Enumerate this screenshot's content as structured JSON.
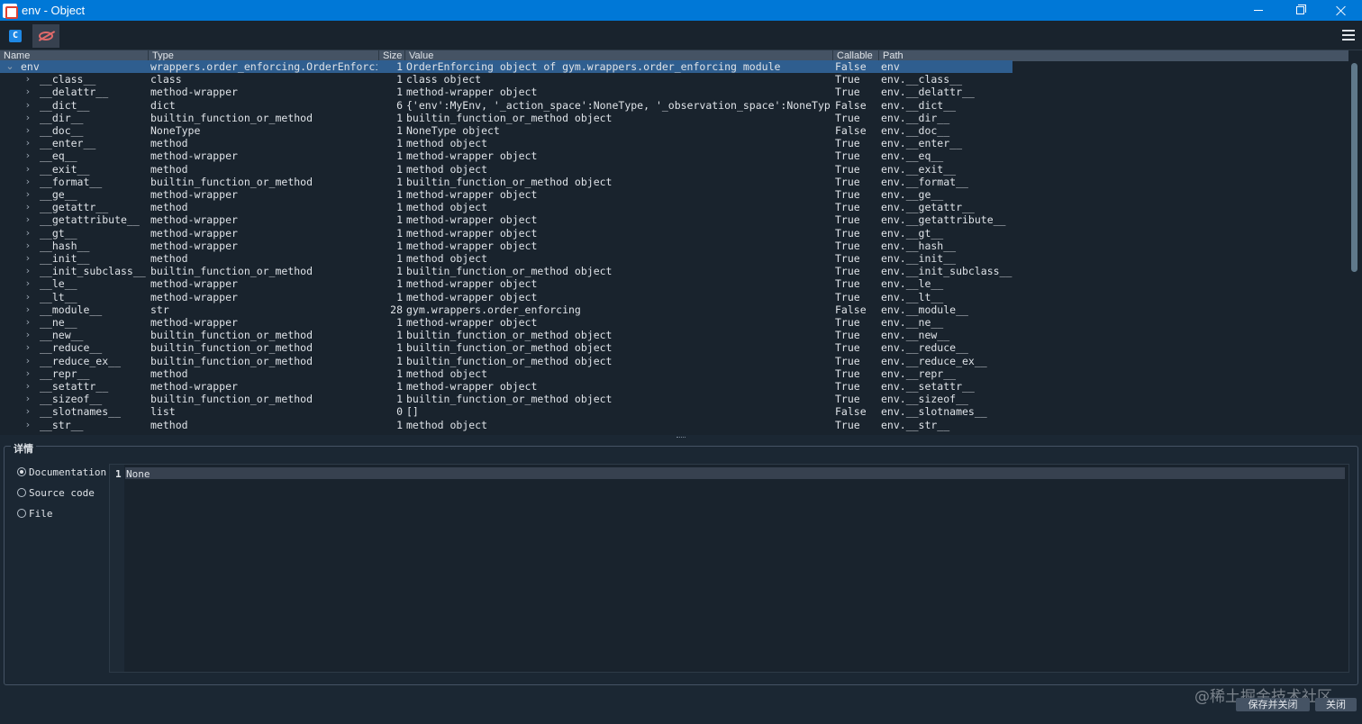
{
  "window": {
    "title": "env - Object"
  },
  "toolbar": {
    "button1_label": "C"
  },
  "table": {
    "headers": [
      "Name",
      "Type",
      "Size",
      "Value",
      "Callable",
      "Path"
    ],
    "rows": [
      {
        "name": "env",
        "type": "wrappers.order_enforcing.OrderEnforcing",
        "size": "1",
        "value": "OrderEnforcing object of gym.wrappers.order_enforcing module",
        "callable": "False",
        "path": "env",
        "expanded": true,
        "selected": true
      },
      {
        "name": "__class__",
        "type": "class",
        "size": "1",
        "value": "class object",
        "callable": "True",
        "path": "env.__class__"
      },
      {
        "name": "__delattr__",
        "type": "method-wrapper",
        "size": "1",
        "value": "method-wrapper object",
        "callable": "True",
        "path": "env.__delattr__"
      },
      {
        "name": "__dict__",
        "type": "dict",
        "size": "6",
        "value": "{'env':MyEnv, '_action_space':NoneType, '_observation_space':NoneType, ...",
        "callable": "False",
        "path": "env.__dict__"
      },
      {
        "name": "__dir__",
        "type": "builtin_function_or_method",
        "size": "1",
        "value": "builtin_function_or_method object",
        "callable": "True",
        "path": "env.__dir__"
      },
      {
        "name": "__doc__",
        "type": "NoneType",
        "size": "1",
        "value": "NoneType object",
        "callable": "False",
        "path": "env.__doc__"
      },
      {
        "name": "__enter__",
        "type": "method",
        "size": "1",
        "value": "method object",
        "callable": "True",
        "path": "env.__enter__"
      },
      {
        "name": "__eq__",
        "type": "method-wrapper",
        "size": "1",
        "value": "method-wrapper object",
        "callable": "True",
        "path": "env.__eq__"
      },
      {
        "name": "__exit__",
        "type": "method",
        "size": "1",
        "value": "method object",
        "callable": "True",
        "path": "env.__exit__"
      },
      {
        "name": "__format__",
        "type": "builtin_function_or_method",
        "size": "1",
        "value": "builtin_function_or_method object",
        "callable": "True",
        "path": "env.__format__"
      },
      {
        "name": "__ge__",
        "type": "method-wrapper",
        "size": "1",
        "value": "method-wrapper object",
        "callable": "True",
        "path": "env.__ge__"
      },
      {
        "name": "__getattr__",
        "type": "method",
        "size": "1",
        "value": "method object",
        "callable": "True",
        "path": "env.__getattr__"
      },
      {
        "name": "__getattribute__",
        "type": "method-wrapper",
        "size": "1",
        "value": "method-wrapper object",
        "callable": "True",
        "path": "env.__getattribute__"
      },
      {
        "name": "__gt__",
        "type": "method-wrapper",
        "size": "1",
        "value": "method-wrapper object",
        "callable": "True",
        "path": "env.__gt__"
      },
      {
        "name": "__hash__",
        "type": "method-wrapper",
        "size": "1",
        "value": "method-wrapper object",
        "callable": "True",
        "path": "env.__hash__"
      },
      {
        "name": "__init__",
        "type": "method",
        "size": "1",
        "value": "method object",
        "callable": "True",
        "path": "env.__init__"
      },
      {
        "name": "__init_subclass__",
        "type": "builtin_function_or_method",
        "size": "1",
        "value": "builtin_function_or_method object",
        "callable": "True",
        "path": "env.__init_subclass__"
      },
      {
        "name": "__le__",
        "type": "method-wrapper",
        "size": "1",
        "value": "method-wrapper object",
        "callable": "True",
        "path": "env.__le__"
      },
      {
        "name": "__lt__",
        "type": "method-wrapper",
        "size": "1",
        "value": "method-wrapper object",
        "callable": "True",
        "path": "env.__lt__"
      },
      {
        "name": "__module__",
        "type": "str",
        "size": "28",
        "value": "gym.wrappers.order_enforcing",
        "callable": "False",
        "path": "env.__module__"
      },
      {
        "name": "__ne__",
        "type": "method-wrapper",
        "size": "1",
        "value": "method-wrapper object",
        "callable": "True",
        "path": "env.__ne__"
      },
      {
        "name": "__new__",
        "type": "builtin_function_or_method",
        "size": "1",
        "value": "builtin_function_or_method object",
        "callable": "True",
        "path": "env.__new__"
      },
      {
        "name": "__reduce__",
        "type": "builtin_function_or_method",
        "size": "1",
        "value": "builtin_function_or_method object",
        "callable": "True",
        "path": "env.__reduce__"
      },
      {
        "name": "__reduce_ex__",
        "type": "builtin_function_or_method",
        "size": "1",
        "value": "builtin_function_or_method object",
        "callable": "True",
        "path": "env.__reduce_ex__"
      },
      {
        "name": "__repr__",
        "type": "method",
        "size": "1",
        "value": "method object",
        "callable": "True",
        "path": "env.__repr__"
      },
      {
        "name": "__setattr__",
        "type": "method-wrapper",
        "size": "1",
        "value": "method-wrapper object",
        "callable": "True",
        "path": "env.__setattr__"
      },
      {
        "name": "__sizeof__",
        "type": "builtin_function_or_method",
        "size": "1",
        "value": "builtin_function_or_method object",
        "callable": "True",
        "path": "env.__sizeof__"
      },
      {
        "name": "__slotnames__",
        "type": "list",
        "size": "0",
        "value": "[]",
        "callable": "False",
        "path": "env.__slotnames__"
      },
      {
        "name": "__str__",
        "type": "method",
        "size": "1",
        "value": "method object",
        "callable": "True",
        "path": "env.__str__"
      }
    ]
  },
  "details": {
    "legend": "详情",
    "options": [
      {
        "label": "Documentation",
        "checked": true
      },
      {
        "label": "Source code",
        "checked": false
      },
      {
        "label": "File",
        "checked": false
      }
    ],
    "editor": {
      "line_number": "1",
      "text": "None"
    }
  },
  "watermark": "@稀土掘金技术社区",
  "buttons": {
    "save_close": "保存并关闭",
    "close": "关闭"
  },
  "colors": {
    "titlebar": "#0078d7",
    "selected_row": "#2f5e8f",
    "background": "#19232d"
  }
}
